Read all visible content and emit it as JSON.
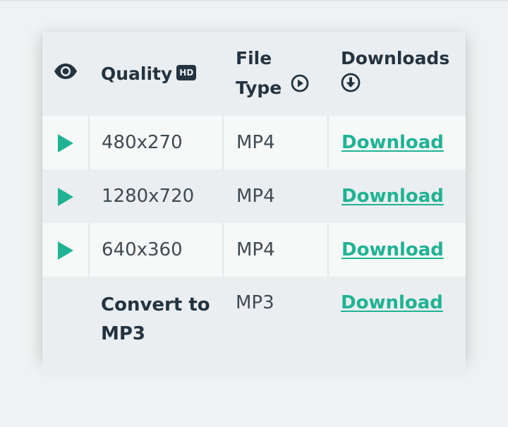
{
  "table": {
    "headers": {
      "quality": "Quality",
      "hd_badge": "HD",
      "file_type_line1": "File",
      "file_type_line2": "Type",
      "downloads": "Downloads"
    },
    "rows": [
      {
        "quality": "480x270",
        "type": "MP4",
        "download": "Download",
        "has_play": true
      },
      {
        "quality": "1280x720",
        "type": "MP4",
        "download": "Download",
        "has_play": true
      },
      {
        "quality": "640x360",
        "type": "MP4",
        "download": "Download",
        "has_play": true
      },
      {
        "quality_line1": "Convert to",
        "quality_line2": "MP3",
        "type": "MP3",
        "download": "Download",
        "has_play": false
      }
    ]
  },
  "icons": {
    "view": "eye-icon",
    "hd": "hd-icon",
    "file_type": "play-circle-icon",
    "downloads": "download-circle-icon",
    "row_play": "play-icon"
  },
  "colors": {
    "accent": "#1fb394",
    "heading": "#243340",
    "text": "#3f4a52",
    "row_light": "#f7f8f8",
    "row_dark": "#eaeef0"
  }
}
